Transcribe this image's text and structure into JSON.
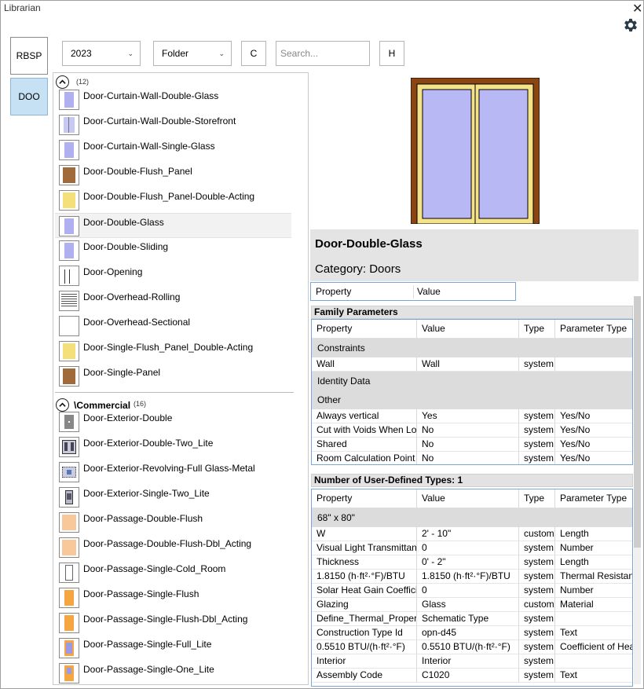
{
  "window": {
    "title": "Librarian",
    "close_glyph": "✕"
  },
  "sidebar": {
    "buttons": [
      {
        "label": "RBSP",
        "active": false
      },
      {
        "label": "DOO",
        "active": true
      }
    ]
  },
  "toolbar": {
    "year_value": "2023",
    "view_value": "Folder",
    "c_label": "C",
    "search_placeholder": "Search...",
    "h_label": "H"
  },
  "list": {
    "group1": {
      "count": "(12)",
      "items": [
        {
          "label": "Door-Curtain-Wall-Double-Glass",
          "icon": "glass-door-icon"
        },
        {
          "label": "Door-Curtain-Wall-Double-Storefront",
          "icon": "storefront-door-icon"
        },
        {
          "label": "Door-Curtain-Wall-Single-Glass",
          "icon": "glass-door-icon"
        },
        {
          "label": "Door-Double-Flush_Panel",
          "icon": "wood-door-icon"
        },
        {
          "label": "Door-Double-Flush_Panel-Double-Acting",
          "icon": "yellow-door-icon"
        },
        {
          "label": "Door-Double-Glass",
          "icon": "glass-door-icon",
          "selected": true
        },
        {
          "label": "Door-Double-Sliding",
          "icon": "glass-door-icon"
        },
        {
          "label": "Door-Opening",
          "icon": "opening-icon"
        },
        {
          "label": "Door-Overhead-Rolling",
          "icon": "rolling-door-icon"
        },
        {
          "label": "Door-Overhead-Sectional",
          "icon": "blank-icon"
        },
        {
          "label": "Door-Single-Flush_Panel_Double-Acting",
          "icon": "yellow-door-icon"
        },
        {
          "label": "Door-Single-Panel",
          "icon": "wood-door-icon"
        }
      ]
    },
    "group2": {
      "name": "\\Commercial",
      "count": "(16)",
      "items": [
        {
          "label": "Door-Exterior-Double",
          "icon": "grey-door-icon"
        },
        {
          "label": "Door-Exterior-Double-Two_Lite",
          "icon": "two-lite-door-icon"
        },
        {
          "label": "Door-Exterior-Revolving-Full Glass-Metal",
          "icon": "revolving-door-icon"
        },
        {
          "label": "Door-Exterior-Single-Two_Lite",
          "icon": "single-lite-door-icon"
        },
        {
          "label": "Door-Passage-Double-Flush",
          "icon": "peach-door-icon"
        },
        {
          "label": "Door-Passage-Double-Flush-Dbl_Acting",
          "icon": "peach-door-icon"
        },
        {
          "label": "Door-Passage-Single-Cold_Room",
          "icon": "cold-room-door-icon"
        },
        {
          "label": "Door-Passage-Single-Flush",
          "icon": "orange-door-icon"
        },
        {
          "label": "Door-Passage-Single-Flush-Dbl_Acting",
          "icon": "orange-door-icon"
        },
        {
          "label": "Door-Passage-Single-Full_Lite",
          "icon": "full-lite-door-icon"
        },
        {
          "label": "Door-Passage-Single-One_Lite",
          "icon": "one-lite-door-icon"
        }
      ]
    }
  },
  "detail": {
    "name": "Door-Double-Glass",
    "category": "Category: Doors",
    "pv_header": {
      "property": "Property",
      "value": "Value"
    },
    "family_section": "Family Parameters",
    "family_headers": [
      "Property",
      "Value",
      "Type",
      "Parameter Type"
    ],
    "family_rows": [
      {
        "group": "Constraints"
      },
      {
        "cells": [
          "Wall",
          "Wall",
          "system",
          ""
        ]
      },
      {
        "group": "Identity Data"
      },
      {
        "group": "Other"
      },
      {
        "cells": [
          "Always vertical",
          "Yes",
          "system",
          "Yes/No"
        ]
      },
      {
        "cells": [
          "Cut with Voids When Loaded",
          "No",
          "system",
          "Yes/No"
        ]
      },
      {
        "cells": [
          "Shared",
          "No",
          "system",
          "Yes/No"
        ]
      },
      {
        "cells": [
          "Room Calculation Point",
          "No",
          "system",
          "Yes/No"
        ]
      }
    ],
    "types_section": "Number of User-Defined Types:  1",
    "type_headers": [
      "Property",
      "Value",
      "Type",
      "Parameter Type"
    ],
    "type_rows": [
      {
        "group": "68\" x 80\""
      },
      {
        "cells": [
          "W",
          "2' - 10\"",
          "custom",
          "Length"
        ]
      },
      {
        "cells": [
          "Visual Light Transmittance",
          "0",
          "system",
          "Number"
        ]
      },
      {
        "cells": [
          "Thickness",
          "0' - 2\"",
          "system",
          "Length"
        ]
      },
      {
        "cells": [
          "1.8150 (h·ft²·°F)/BTU",
          "1.8150 (h·ft²·°F)/BTU",
          "system",
          "Thermal Resistance"
        ]
      },
      {
        "cells": [
          "Solar Heat Gain Coefficient",
          "0",
          "system",
          "Number"
        ]
      },
      {
        "cells": [
          "Glazing",
          "Glass",
          "custom",
          "Material"
        ]
      },
      {
        "cells": [
          "Define_Thermal_Properties",
          "Schematic Type",
          "system",
          ""
        ]
      },
      {
        "cells": [
          "Construction Type Id",
          "opn-d45",
          "system",
          "Text"
        ]
      },
      {
        "cells": [
          "0.5510 BTU/(h·ft²·°F)",
          "0.5510 BTU/(h·ft²·°F)",
          "system",
          "Coefficient of Heat Transfer"
        ]
      },
      {
        "cells": [
          "Interior",
          "Interior",
          "system",
          ""
        ]
      },
      {
        "cells": [
          "Assembly Code",
          "C1020",
          "system",
          "Text"
        ]
      }
    ]
  }
}
